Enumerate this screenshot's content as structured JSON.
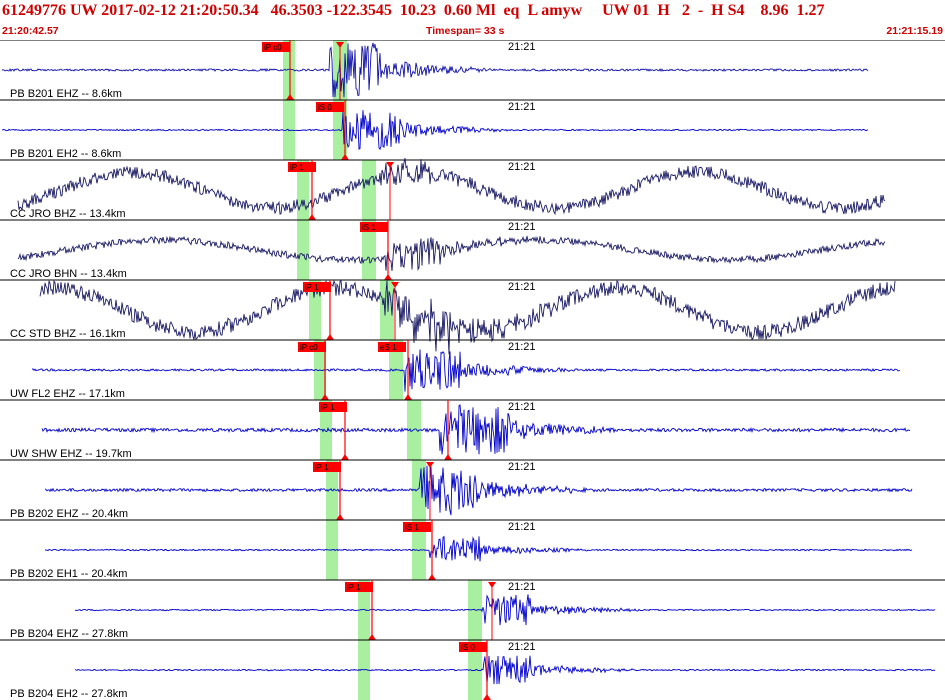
{
  "header": {
    "event_line": "61249776 UW 2017-02-12 21:20:50.34   46.3503 -122.3545  10.23  0.60 Ml  eq  L amyw     UW 01  H   2  -  H S4    8.96  1.27",
    "start_time": "21:20:42.57",
    "timespan": "Timespan=  33 s",
    "end_time": "21:21:15.19"
  },
  "time_mark_label": "21:21",
  "colors": {
    "header_text": "#d00000",
    "trace_blue": "#0000cc",
    "trace_navy": "#1a1a66",
    "pick_red": "#ff0000",
    "window_green": "#a8f0a0",
    "divider": "#000000"
  },
  "traces": [
    {
      "label": "PB B201 EHZ -- 8.6km",
      "color": "navy_blue",
      "p_pick": "iP c0",
      "s_pick": ""
    },
    {
      "label": "PB B201 EH2 -- 8.6km",
      "color": "blue",
      "p_pick": "",
      "s_pick": "iS 0"
    },
    {
      "label": "CC JRO BHZ -- 13.4km",
      "color": "navy",
      "p_pick": "iP 1",
      "s_pick": ""
    },
    {
      "label": "CC JRO BHN -- 13.4km",
      "color": "navy",
      "p_pick": "",
      "s_pick": "iS 1"
    },
    {
      "label": "CC STD BHZ -- 16.1km",
      "color": "navy",
      "p_pick": "iP 1",
      "s_pick": ""
    },
    {
      "label": "UW FL2 EHZ -- 17.1km",
      "color": "blue",
      "p_pick": "iP c0",
      "s_pick": "eS 1"
    },
    {
      "label": "UW SHW EHZ -- 19.7km",
      "color": "blue",
      "p_pick": "iP 1",
      "s_pick": ""
    },
    {
      "label": "PB B202 EHZ -- 20.4km",
      "color": "blue",
      "p_pick": "iP 1",
      "s_pick": ""
    },
    {
      "label": "PB B202 EH1 -- 20.4km",
      "color": "blue",
      "p_pick": "",
      "s_pick": "iS 1"
    },
    {
      "label": "PB B204 EHZ -- 27.8km",
      "color": "blue",
      "p_pick": "iP 1",
      "s_pick": ""
    },
    {
      "label": "PB B204 EH2 -- 27.8km",
      "color": "blue",
      "p_pick": "",
      "s_pick": "iS 0"
    }
  ]
}
